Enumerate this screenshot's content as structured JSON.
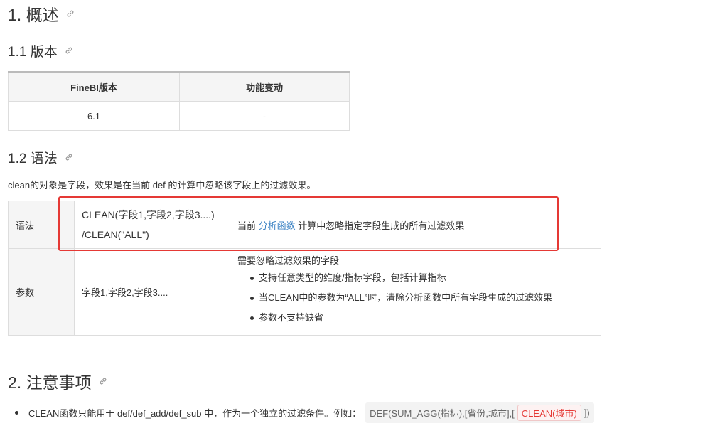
{
  "sections": {
    "s1": "1. 概述",
    "s11": "1.1 版本",
    "s12": "1.2 语法",
    "s2": "2. 注意事项"
  },
  "version_table": {
    "headers": [
      "FineBI版本",
      "功能变动"
    ],
    "rows": [
      [
        "6.1",
        "-"
      ]
    ]
  },
  "intro_text": "clean的对象是字段，效果是在当前 def 的计算中忽略该字段上的过滤效果。",
  "syntax_table": {
    "row1": {
      "label": "语法",
      "syntax_line1": "CLEAN(字段1,字段2,字段3....)",
      "syntax_line2": "/CLEAN(\"ALL\")",
      "desc_prefix": "当前 ",
      "desc_link": "分析函数",
      "desc_suffix": " 计算中忽略指定字段生成的所有过滤效果"
    },
    "row2": {
      "label": "参数",
      "params": "字段1,字段2,字段3....",
      "desc_title": "需要忽略过滤效果的字段",
      "bullets": [
        "支持任意类型的维度/指标字段，包括计算指标",
        "当CLEAN中的参数为“ALL”时，清除分析函数中所有字段生成的过滤效果",
        "参数不支持缺省"
      ]
    }
  },
  "note": {
    "text": "CLEAN函数只能用于 def/def_add/def_sub 中，作为一个独立的过滤条件。例如：",
    "code_prefix": "DEF(SUM_AGG(指标),[省份,城市],[",
    "code_highlight": "CLEAN(城市)",
    "code_suffix": "])"
  },
  "colors": {
    "link": "#3c83c4",
    "highlight_box": "#e53935"
  }
}
